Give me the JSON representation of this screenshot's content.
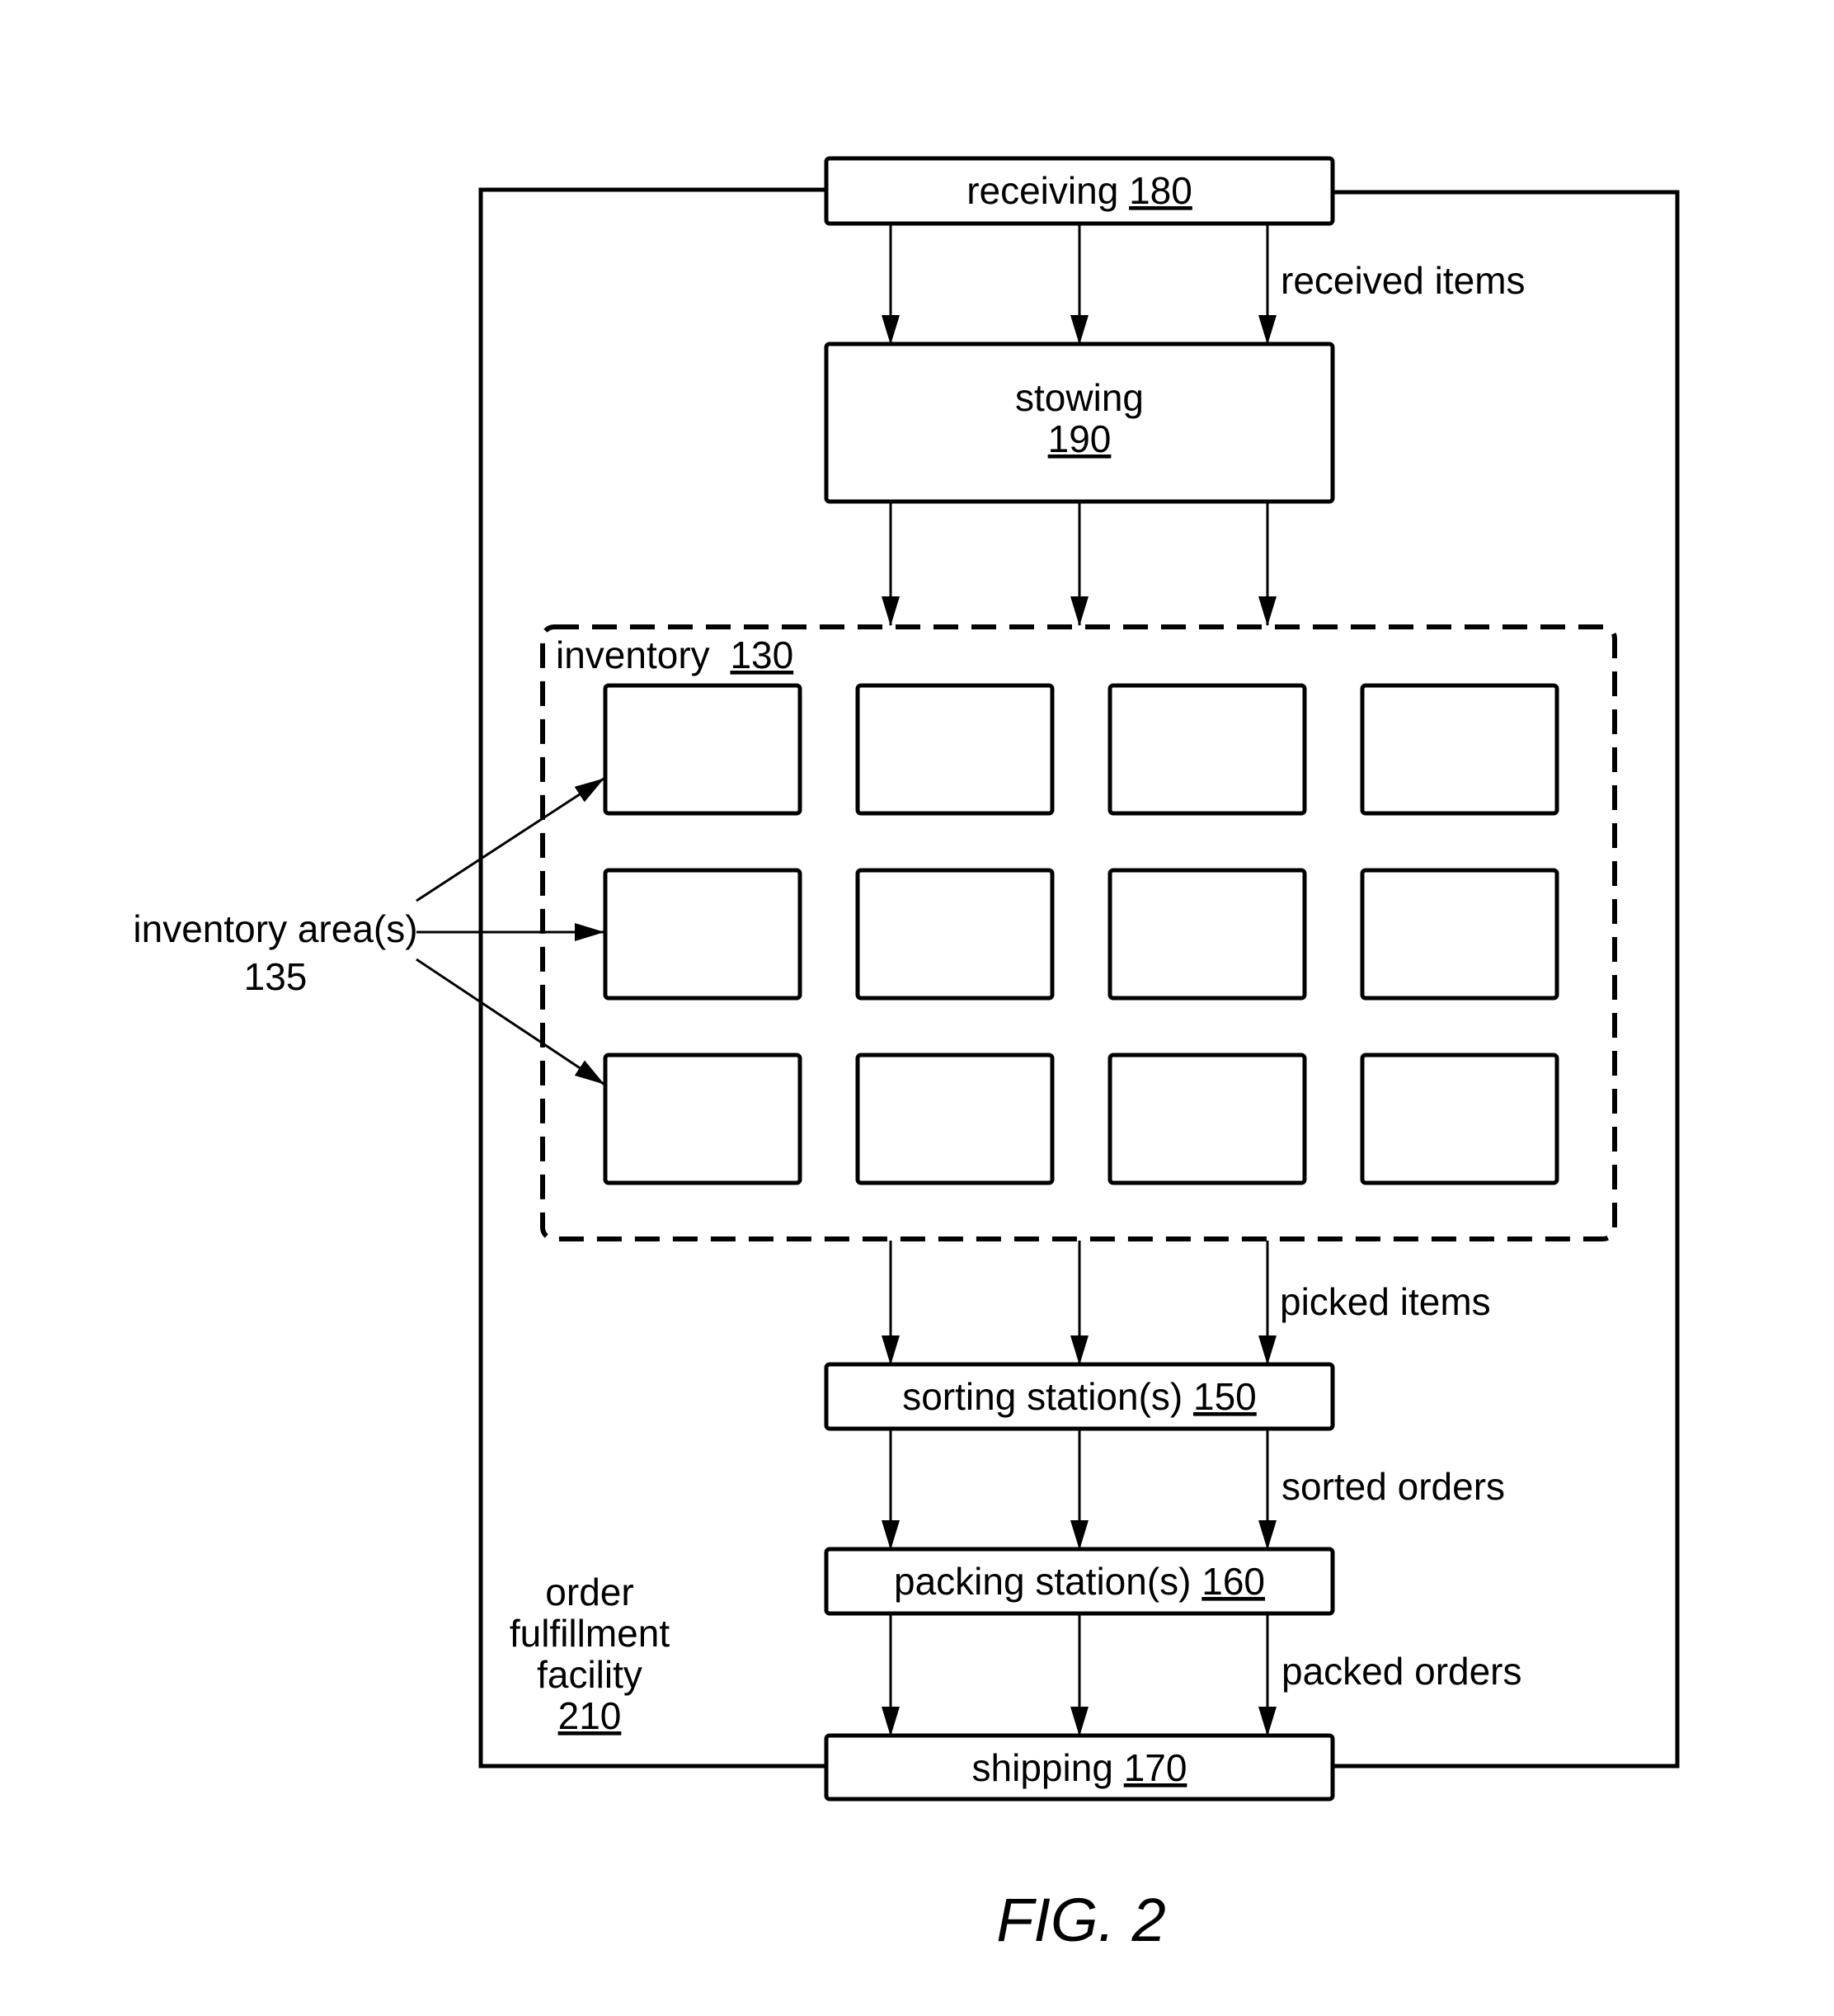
{
  "figure_label": "FIG. 2",
  "facility": {
    "lines": [
      "order",
      "fulfillment",
      "facility"
    ],
    "ref": "210"
  },
  "boxes": {
    "receiving": {
      "label": "receiving",
      "ref": "180"
    },
    "stowing": {
      "label": "stowing",
      "ref": "190"
    },
    "sorting": {
      "label": "sorting station(s)",
      "ref": "150"
    },
    "packing": {
      "label": "packing station(s)",
      "ref": "160"
    },
    "shipping": {
      "label": "shipping",
      "ref": "170"
    }
  },
  "inventory": {
    "label": "inventory",
    "ref": "130",
    "grid_rows": 3,
    "grid_cols": 4
  },
  "inventory_areas": {
    "label": "inventory area(s)",
    "ref": "135"
  },
  "flow_labels": {
    "received": "received items",
    "picked": "picked items",
    "sorted": "sorted orders",
    "packed": "packed orders"
  }
}
